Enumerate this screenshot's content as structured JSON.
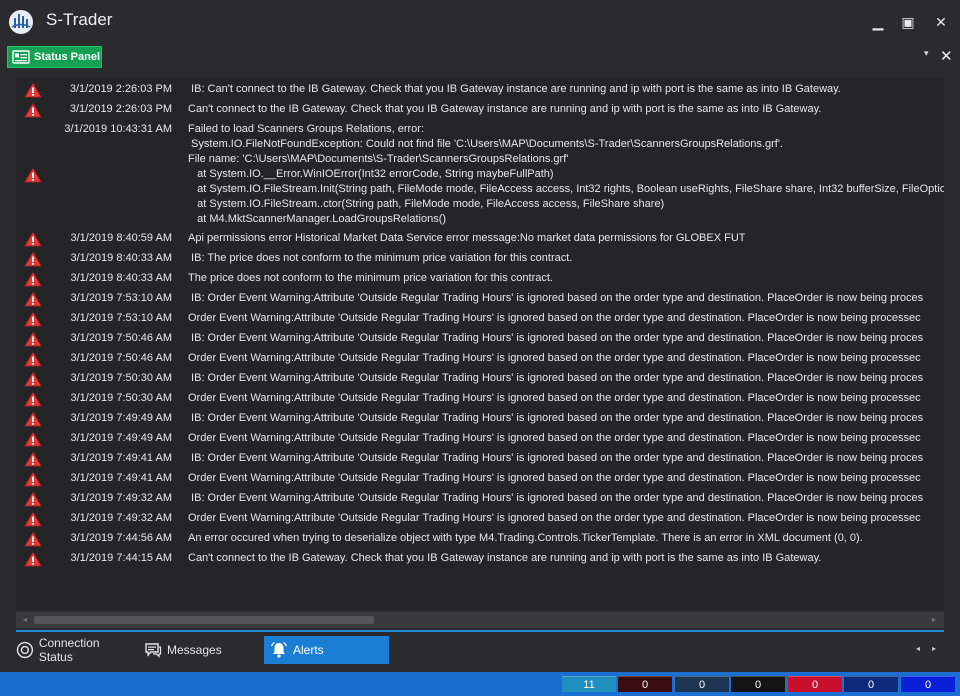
{
  "app": {
    "title": "S-Trader"
  },
  "window_controls": {
    "minimize": "▁",
    "maximize": "▣",
    "close": "✕"
  },
  "panel": {
    "tab_label": "Status Panel",
    "menu_glyph": "▾",
    "close_glyph": "✕"
  },
  "log": [
    {
      "time": "3/1/2019 2:26:03 PM",
      "message": " IB: Can't connect to the IB Gateway. Check that you IB Gateway instance are running and ip with port is the same as into IB Gateway."
    },
    {
      "time": "3/1/2019 2:26:03 PM",
      "message": "Can't connect to the IB Gateway. Check that you IB Gateway instance are running and ip with port is the same as into IB Gateway."
    },
    {
      "time": "3/1/2019 10:43:31 AM",
      "message": "Failed to load Scanners Groups Relations, error:\n System.IO.FileNotFoundException: Could not find file 'C:\\Users\\MAP\\Documents\\S-Trader\\ScannersGroupsRelations.grf'.\nFile name: 'C:\\Users\\MAP\\Documents\\S-Trader\\ScannersGroupsRelations.grf'\n   at System.IO.__Error.WinIOError(Int32 errorCode, String maybeFullPath)\n   at System.IO.FileStream.Init(String path, FileMode mode, FileAccess access, Int32 rights, Boolean useRights, FileShare share, Int32 bufferSize, FileOptio\n   at System.IO.FileStream..ctor(String path, FileMode mode, FileAccess access, FileShare share)\n   at M4.MktScannerManager.LoadGroupsRelations()",
      "icon_offset": true
    },
    {
      "time": "3/1/2019 8:40:59 AM",
      "message": "Api permissions error Historical Market Data Service error message:No market data permissions for GLOBEX FUT"
    },
    {
      "time": "3/1/2019 8:40:33 AM",
      "message": " IB: The price does not conform to the minimum price variation for this contract."
    },
    {
      "time": "3/1/2019 8:40:33 AM",
      "message": "The price does not conform to the minimum price variation for this contract."
    },
    {
      "time": "3/1/2019 7:53:10 AM",
      "message": " IB: Order Event Warning:Attribute 'Outside Regular Trading Hours' is ignored based on the order type and destination. PlaceOrder is now being proces"
    },
    {
      "time": "3/1/2019 7:53:10 AM",
      "message": "Order Event Warning:Attribute 'Outside Regular Trading Hours' is ignored based on the order type and destination. PlaceOrder is now being processec"
    },
    {
      "time": "3/1/2019 7:50:46 AM",
      "message": " IB: Order Event Warning:Attribute 'Outside Regular Trading Hours' is ignored based on the order type and destination. PlaceOrder is now being proces"
    },
    {
      "time": "3/1/2019 7:50:46 AM",
      "message": "Order Event Warning:Attribute 'Outside Regular Trading Hours' is ignored based on the order type and destination. PlaceOrder is now being processec"
    },
    {
      "time": "3/1/2019 7:50:30 AM",
      "message": " IB: Order Event Warning:Attribute 'Outside Regular Trading Hours' is ignored based on the order type and destination. PlaceOrder is now being proces"
    },
    {
      "time": "3/1/2019 7:50:30 AM",
      "message": "Order Event Warning:Attribute 'Outside Regular Trading Hours' is ignored based on the order type and destination. PlaceOrder is now being processec"
    },
    {
      "time": "3/1/2019 7:49:49 AM",
      "message": " IB: Order Event Warning:Attribute 'Outside Regular Trading Hours' is ignored based on the order type and destination. PlaceOrder is now being proces"
    },
    {
      "time": "3/1/2019 7:49:49 AM",
      "message": "Order Event Warning:Attribute 'Outside Regular Trading Hours' is ignored based on the order type and destination. PlaceOrder is now being processec"
    },
    {
      "time": "3/1/2019 7:49:41 AM",
      "message": " IB: Order Event Warning:Attribute 'Outside Regular Trading Hours' is ignored based on the order type and destination. PlaceOrder is now being proces"
    },
    {
      "time": "3/1/2019 7:49:41 AM",
      "message": "Order Event Warning:Attribute 'Outside Regular Trading Hours' is ignored based on the order type and destination. PlaceOrder is now being processec"
    },
    {
      "time": "3/1/2019 7:49:32 AM",
      "message": " IB: Order Event Warning:Attribute 'Outside Regular Trading Hours' is ignored based on the order type and destination. PlaceOrder is now being proces"
    },
    {
      "time": "3/1/2019 7:49:32 AM",
      "message": "Order Event Warning:Attribute 'Outside Regular Trading Hours' is ignored based on the order type and destination. PlaceOrder is now being processec"
    },
    {
      "time": "3/1/2019 7:44:56 AM",
      "message": "An error occured when trying to deserialize object with type M4.Trading.Controls.TickerTemplate. There is an error in XML document (0, 0)."
    },
    {
      "time": "3/1/2019 7:44:15 AM",
      "message": "Can't connect to the IB Gateway. Check that you IB Gateway instance are running and ip with port is the same as into IB Gateway."
    }
  ],
  "scrollbar": {
    "left": "◂",
    "right": "▸"
  },
  "tabs": [
    {
      "label": "Connection Status",
      "icon": "connection-icon",
      "active": false
    },
    {
      "label": "Messages",
      "icon": "messages-icon",
      "active": false
    },
    {
      "label": "Alerts",
      "icon": "alerts-icon",
      "active": true
    }
  ],
  "tabs_nav": {
    "prev": "◂",
    "next": "▸"
  },
  "status_counters": [
    {
      "value": "11",
      "color": "#1f8fc0"
    },
    {
      "value": "0",
      "color": "#3a0d12"
    },
    {
      "value": "0",
      "color": "#1c3550"
    },
    {
      "value": "0",
      "color": "#141414"
    },
    {
      "value": "0",
      "color": "#c8102e"
    },
    {
      "value": "0",
      "color": "#0f2a7a"
    },
    {
      "value": "0",
      "color": "#0a1fd8"
    }
  ],
  "colors": {
    "accent": "#1a7fd4",
    "panel_tab": "#14a154",
    "warning": "#e03030"
  }
}
